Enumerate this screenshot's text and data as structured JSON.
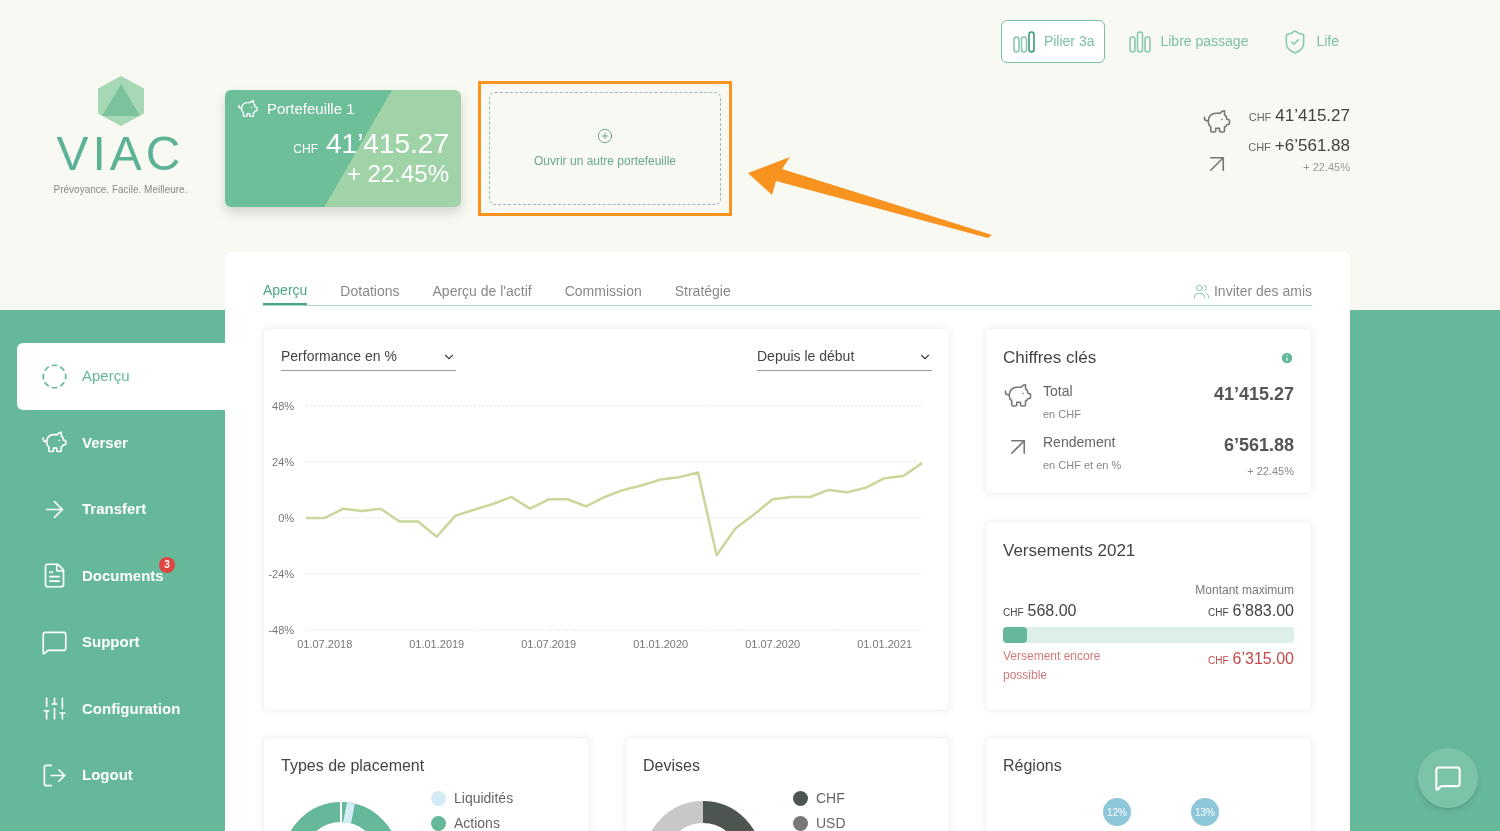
{
  "logo": {
    "wordmark": "VIAC",
    "tagline": "Prévoyance. Facile. Meilleure."
  },
  "portfolio_card": {
    "title": "Portefeuille 1",
    "currency": "CHF",
    "amount": "41’415.27",
    "performance": "+ 22.45%"
  },
  "open_portfolio": {
    "label": "Ouvrir un autre portefeuille",
    "highlighted": true
  },
  "product_tabs": [
    {
      "label": "Pilier 3a",
      "selected": true,
      "kind": "pillar"
    },
    {
      "label": "Libre passage",
      "selected": false,
      "kind": "vested"
    },
    {
      "label": "Life",
      "selected": false,
      "kind": "life"
    }
  ],
  "summary": {
    "total_currency": "CHF",
    "total": "41’415.27",
    "return_currency": "CHF",
    "return": "+6’561.88",
    "return_pct": "+ 22.45%"
  },
  "sidebar": {
    "items": [
      {
        "label": "Aperçu",
        "selected": true,
        "kind": "overview"
      },
      {
        "label": "Verser",
        "selected": false,
        "kind": "deposit"
      },
      {
        "label": "Transfert",
        "selected": false,
        "kind": "transfer"
      },
      {
        "label": "Documents",
        "selected": false,
        "kind": "documents",
        "badge": "3"
      },
      {
        "label": "Support",
        "selected": false,
        "kind": "support"
      },
      {
        "label": "Configuration",
        "selected": false,
        "kind": "settings"
      },
      {
        "label": "Logout",
        "selected": false,
        "kind": "logout"
      }
    ]
  },
  "tabs": [
    {
      "label": "Aperçu",
      "selected": true
    },
    {
      "label": "Dotations",
      "selected": false
    },
    {
      "label": "Aperçu de l'actif",
      "selected": false
    },
    {
      "label": "Commission",
      "selected": false
    },
    {
      "label": "Stratégie",
      "selected": false
    }
  ],
  "invite": {
    "label": "Inviter des amis"
  },
  "performance": {
    "metric_select": "Performance en %",
    "period_select": "Depuis le début",
    "chart_data": {
      "type": "line",
      "categories": [
        null,
        "01.07.2018",
        null,
        null,
        null,
        null,
        null,
        "01.01.2019",
        null,
        null,
        null,
        null,
        null,
        "01.07.2019",
        null,
        null,
        null,
        null,
        null,
        "01.01.2020",
        null,
        null,
        null,
        null,
        null,
        "01.07.2020",
        null,
        null,
        null,
        null,
        null,
        "01.01.2021",
        null,
        null
      ],
      "series": [
        {
          "color": "#c9d89a",
          "values": [
            0,
            0,
            4,
            3,
            4,
            -1.5,
            -1.5,
            -8,
            1,
            3.5,
            6,
            9,
            4,
            8,
            8,
            5,
            9,
            12,
            14,
            16.5,
            17.5,
            19.5,
            -16,
            -4.5,
            1.5,
            8,
            9,
            9,
            12,
            11,
            13,
            17,
            18,
            23.5
          ]
        }
      ],
      "ylim": [
        -48,
        48
      ],
      "grid": true,
      "yticks": [
        {
          "value": 48,
          "label": "48%"
        },
        {
          "value": 24,
          "label": "24%"
        },
        {
          "value": 0,
          "label": "0%"
        },
        {
          "value": -24,
          "label": "-24%"
        },
        {
          "value": -48,
          "label": "-48%"
        }
      ]
    }
  },
  "key_figures": {
    "title": "Chiffres clés",
    "rows": [
      {
        "kind": "total",
        "label": "Total",
        "sublabel": "en CHF",
        "value": "41’415.27"
      },
      {
        "kind": "return",
        "label": "Rendement",
        "sublabel": "en CHF et en %",
        "value": "6’561.88",
        "subvalue": "+ 22.45%"
      }
    ]
  },
  "deposits": {
    "title": "Versements 2021",
    "max_label": "Montant maximum",
    "paid_currency": "CHF",
    "paid": "568.00",
    "max_currency": "CHF",
    "max": "6’883.00",
    "level": 0.0825,
    "remaining_label": "Versement encore possible",
    "remaining_currency": "CHF",
    "remaining": "6’315.00"
  },
  "investment_types": {
    "title": "Types de placement",
    "legend": [
      {
        "label": "Liquidités",
        "color": "#d3ecf5"
      },
      {
        "label": "Actions",
        "color": "#65b89a"
      }
    ]
  },
  "currencies": {
    "title": "Devises",
    "legend": [
      {
        "label": "CHF",
        "color": "#4d5550"
      },
      {
        "label": "USD",
        "color": "#787878"
      }
    ]
  },
  "regions": {
    "title": "Régions",
    "bubbles": [
      "12%",
      "13%"
    ]
  }
}
